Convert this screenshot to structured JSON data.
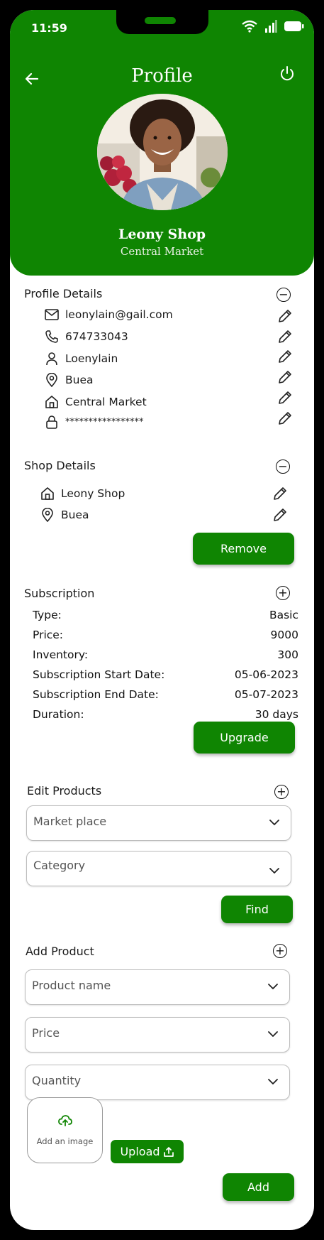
{
  "status_bar": {
    "time": "11:59"
  },
  "header": {
    "title": "Profile",
    "shop_name": "Leony Shop",
    "market": "Central Market"
  },
  "profile_details": {
    "title": "Profile Details",
    "items": [
      {
        "icon": "mail-icon",
        "value": "leonylain@gail.com"
      },
      {
        "icon": "phone-icon",
        "value": "674733043"
      },
      {
        "icon": "user-icon",
        "value": "Loenylain"
      },
      {
        "icon": "location-pin-icon",
        "value": "Buea"
      },
      {
        "icon": "home-icon",
        "value": "Central Market"
      },
      {
        "icon": "lock-icon",
        "value": "*****************"
      }
    ]
  },
  "shop_details": {
    "title": "Shop Details",
    "items": [
      {
        "icon": "home-icon",
        "value": "Leony Shop"
      },
      {
        "icon": "location-pin-icon",
        "value": "Buea"
      }
    ],
    "remove_label": "Remove"
  },
  "subscription": {
    "title": "Subscription",
    "rows": [
      {
        "label": "Type:",
        "value": "Basic"
      },
      {
        "label": "Price:",
        "value": "9000"
      },
      {
        "label": "Inventory:",
        "value": "300"
      },
      {
        "label": "Subscription Start Date:",
        "value": "05-06-2023"
      },
      {
        "label": "Subscription End Date:",
        "value": "05-07-2023"
      },
      {
        "label": "Duration:",
        "value": "30 days"
      }
    ],
    "upgrade_label": "Upgrade"
  },
  "edit_products": {
    "title": "Edit Products",
    "market_placeholder": "Market place",
    "category_placeholder": "Category",
    "find_label": "Find"
  },
  "add_product": {
    "title": "Add Product",
    "name_placeholder": "Product name",
    "price_placeholder": "Price",
    "quantity_placeholder": "Quantity",
    "image_label": "Add an image",
    "upload_label": "Upload",
    "add_label": "Add"
  },
  "colors": {
    "brand_green": "#0f8502",
    "text": "#1b1b1b"
  }
}
